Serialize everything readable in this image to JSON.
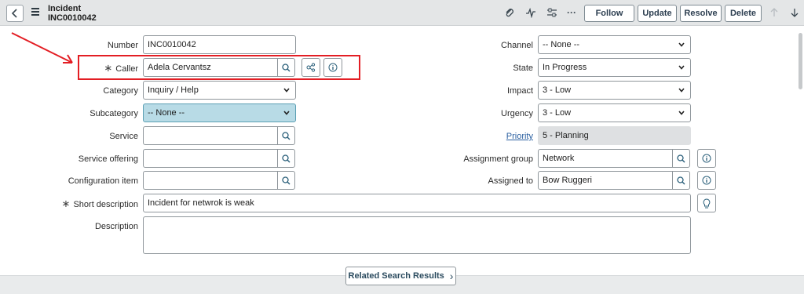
{
  "header": {
    "record_type": "Incident",
    "record_number": "INC0010042",
    "buttons": {
      "follow": "Follow",
      "update": "Update",
      "resolve": "Resolve",
      "delete": "Delete"
    },
    "more_glyph": "···"
  },
  "form": {
    "number": {
      "label": "Number",
      "value": "INC0010042"
    },
    "caller": {
      "label": "Caller",
      "value": "Adela Cervantsz",
      "required_mark": "∗"
    },
    "category": {
      "label": "Category",
      "value": "Inquiry / Help"
    },
    "subcategory": {
      "label": "Subcategory",
      "value": "-- None --"
    },
    "service": {
      "label": "Service",
      "value": ""
    },
    "service_offering": {
      "label": "Service offering",
      "value": ""
    },
    "configuration_item": {
      "label": "Configuration item",
      "value": ""
    },
    "short_description": {
      "label": "Short description",
      "value": "Incident for netwrok is weak",
      "required_mark": "∗"
    },
    "description": {
      "label": "Description",
      "value": ""
    },
    "channel": {
      "label": "Channel",
      "value": "-- None --"
    },
    "state": {
      "label": "State",
      "value": "In Progress"
    },
    "impact": {
      "label": "Impact",
      "value": "3 - Low"
    },
    "urgency": {
      "label": "Urgency",
      "value": "3 - Low"
    },
    "priority": {
      "label": "Priority",
      "value": "5 - Planning"
    },
    "assignment_group": {
      "label": "Assignment group",
      "value": "Network"
    },
    "assigned_to": {
      "label": "Assigned to",
      "value": "Bow Ruggeri"
    }
  },
  "related_search": {
    "label": "Related Search Results",
    "chevron": "›"
  },
  "colors": {
    "annotation": "#e31e24",
    "header_bg": "#e4e6e7",
    "highlight_field": "#b8dbe6",
    "link": "#2a5fa0"
  },
  "icons": [
    "back-chevron-icon",
    "hamburger-menu-icon",
    "paperclip-icon",
    "activity-icon",
    "settings-sliders-icon",
    "more-icon",
    "arrow-up-icon",
    "arrow-down-icon",
    "search-icon",
    "dependency-icon",
    "info-icon",
    "lightbulb-icon",
    "chevron-right-icon"
  ]
}
